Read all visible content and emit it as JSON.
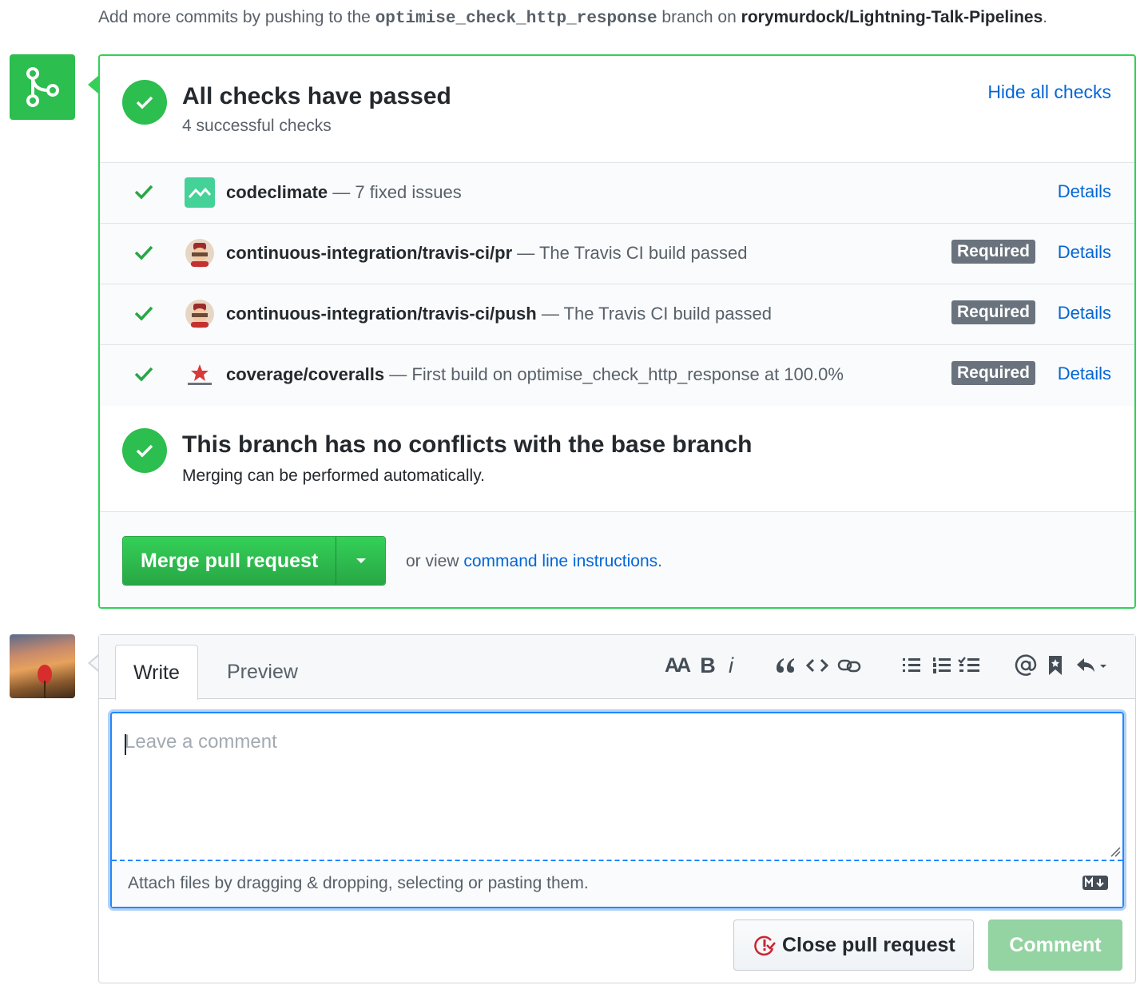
{
  "hint": {
    "prefix": "Add more commits by pushing to the",
    "branch": "optimise_check_http_response",
    "middle": "branch on",
    "repo": "rorymurdock/Lightning-Talk-Pipelines",
    "suffix": "."
  },
  "checks_summary": {
    "title": "All checks have passed",
    "subtitle": "4 successful checks",
    "hide_link": "Hide all checks"
  },
  "checks": [
    {
      "name": "codeclimate",
      "description": "— 7 fixed issues",
      "required": false,
      "required_label": "",
      "details_label": "Details",
      "avatar": "codeclimate-icon"
    },
    {
      "name": "continuous-integration/travis-ci/pr",
      "description": "— The Travis CI build passed",
      "required": true,
      "required_label": "Required",
      "details_label": "Details",
      "avatar": "travis-ci-icon"
    },
    {
      "name": "continuous-integration/travis-ci/push",
      "description": "— The Travis CI build passed",
      "required": true,
      "required_label": "Required",
      "details_label": "Details",
      "avatar": "travis-ci-icon"
    },
    {
      "name": "coverage/coveralls",
      "description": "— First build on optimise_check_http_response at 100.0%",
      "required": true,
      "required_label": "Required",
      "details_label": "Details",
      "avatar": "coveralls-icon"
    }
  ],
  "conflicts": {
    "title": "This branch has no conflicts with the base branch",
    "subtitle": "Merging can be performed automatically."
  },
  "merge": {
    "button_label": "Merge pull request",
    "or_view": "or view",
    "cli_link": "command line instructions",
    "cli_suffix": "."
  },
  "comment": {
    "tabs": [
      "Write",
      "Preview"
    ],
    "active_tab": "Write",
    "placeholder": "Leave a comment",
    "value": "",
    "attach_text": "Attach files by dragging & dropping, selecting or pasting them.",
    "close_label": "Close pull request",
    "comment_label": "Comment",
    "toolbar": {
      "header_label": "AA",
      "bold_label": "B",
      "italic_label": "i"
    }
  },
  "colors": {
    "success": "#2cbe4e",
    "link": "#0366d6",
    "required_badge": "#6a737d"
  }
}
